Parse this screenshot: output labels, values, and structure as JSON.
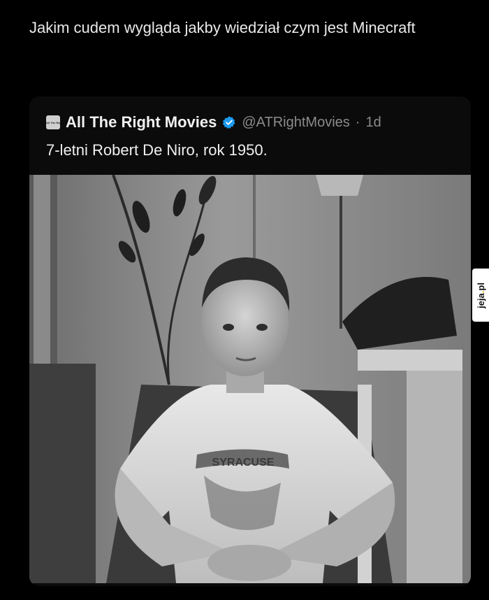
{
  "post": {
    "caption": "Jakim cudem wygląda jakby wiedział czym jest Minecraft"
  },
  "tweet": {
    "avatar_text": "All The Right Movies",
    "display_name": "All The Right Movies",
    "verified_icon": "verified-badge-icon",
    "handle": "@ATRightMovies",
    "separator": "·",
    "time": "1d",
    "text": "7-letni Robert De Niro, rok 1950.",
    "photo_shirt_text": "SYRACUSE"
  },
  "watermark": {
    "text_main": "jeja",
    "text_dot": ".",
    "text_tld": "pl"
  },
  "colors": {
    "background": "#000000",
    "card": "#0b0b0b",
    "handle_gray": "#8b8b8b",
    "verified_blue": "#1d9bf0",
    "watermark_accent": "#f2b705"
  }
}
